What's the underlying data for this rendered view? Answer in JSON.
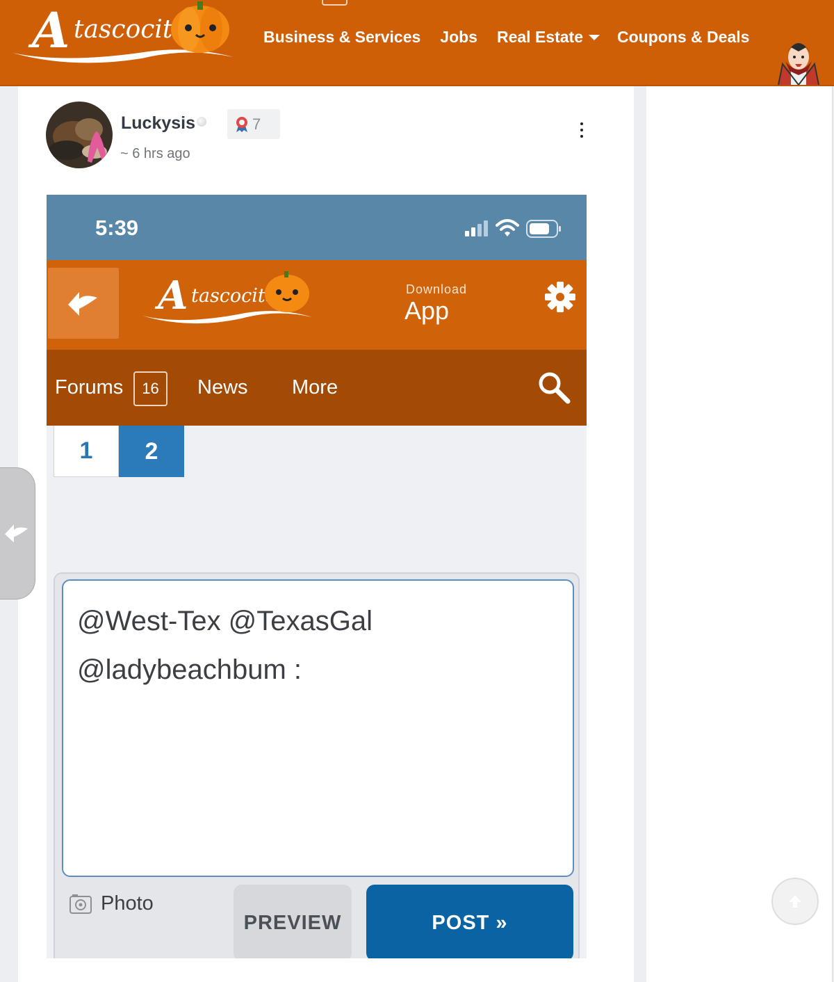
{
  "header": {
    "logo_text": "Atascocita",
    "nav": [
      {
        "label": "Business & Services"
      },
      {
        "label": "Jobs"
      },
      {
        "label": "Real Estate"
      },
      {
        "label": "Coupons & Deals"
      }
    ],
    "avatar_icon": "vampire-avatar-icon"
  },
  "post": {
    "author": "Luckysis",
    "badge_count": "7",
    "time": "~ 6 hrs ago",
    "menu_icon": "more-vertical-icon"
  },
  "screenshot": {
    "status_time": "5:39",
    "download_small": "Download",
    "download_big": "App",
    "nav": {
      "forums": "Forums",
      "forums_count": "16",
      "news": "News",
      "more": "More"
    },
    "pages": [
      "1",
      "2"
    ],
    "active_page": "2",
    "composer_lines": [
      "@West-Tex  @TexasGal",
      "@ladybeachbum  :"
    ],
    "photo_label": "Photo",
    "preview_label": "PREVIEW",
    "post_label": "POST »"
  },
  "colors": {
    "brand_orange": "#cf5f06",
    "nav_dark_orange": "#a34b05",
    "status_blue": "#5887a8",
    "post_blue": "#0a64a4"
  }
}
